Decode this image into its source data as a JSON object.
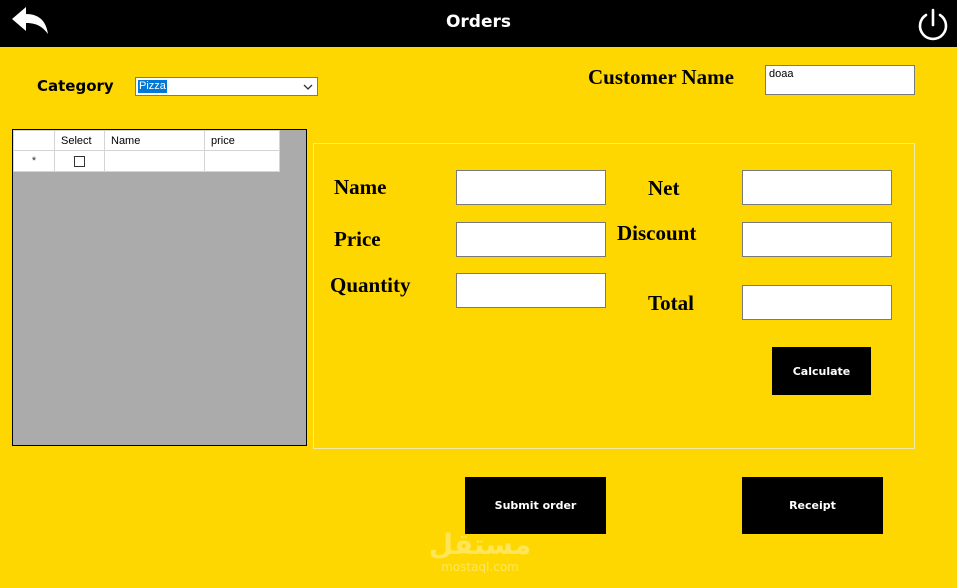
{
  "header": {
    "title": "Orders",
    "back_icon": "back-arrow-icon",
    "power_icon": "power-icon"
  },
  "category": {
    "label": "Category",
    "selected": "Pizza"
  },
  "customer": {
    "label": "Customer Name",
    "value": "doaa"
  },
  "grid": {
    "columns": [
      "Select",
      "Name",
      "price"
    ],
    "new_row_marker": "*"
  },
  "form": {
    "name_label": "Name",
    "price_label": "Price",
    "quantity_label": "Quantity",
    "net_label": "Net",
    "discount_label": "Discount",
    "total_label": "Total",
    "name_value": "",
    "price_value": "",
    "quantity_value": "",
    "net_value": "",
    "discount_value": "",
    "total_value": ""
  },
  "buttons": {
    "calculate": "Calculate",
    "submit": "Submit order",
    "receipt": "Receipt"
  },
  "watermark": {
    "arabic": "مستقل",
    "latin": "mostaql.com"
  },
  "colors": {
    "background": "#FFD700",
    "bar": "#000000",
    "grid_bg": "#ABABAB",
    "selection": "#0078D7"
  }
}
